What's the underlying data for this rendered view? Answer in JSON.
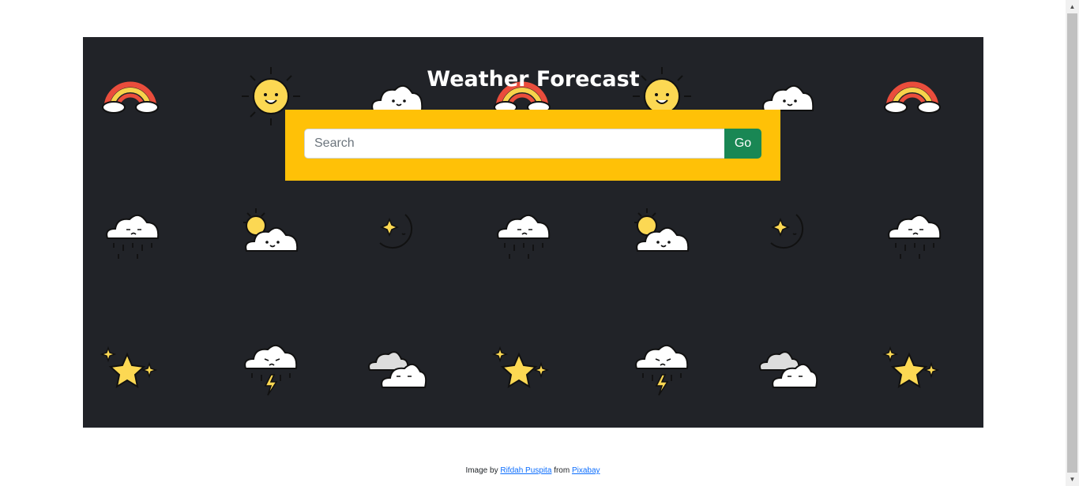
{
  "header": {
    "title": "Weather Forecast"
  },
  "search": {
    "placeholder": "Search",
    "value": "",
    "button_label": "Go"
  },
  "credit": {
    "prefix": "Image by",
    "author": "Rifdah Puspita",
    "middle": "from",
    "source": "Pixabay"
  },
  "background_tiles": [
    [
      "rainbow",
      "sun",
      "cloud",
      "rainbow",
      "sun",
      "cloud",
      "rainbow"
    ],
    [
      "rain-cloud",
      "sun-cloud",
      "moon",
      "rain-cloud",
      "sun-cloud",
      "moon",
      "rain-cloud"
    ],
    [
      "star",
      "storm-cloud",
      "grey-clouds",
      "star",
      "storm-cloud",
      "grey-clouds",
      "star"
    ]
  ],
  "colors": {
    "hero": "#212328",
    "panel": "#ffc107",
    "button": "#198754",
    "link": "#0d6efd"
  }
}
